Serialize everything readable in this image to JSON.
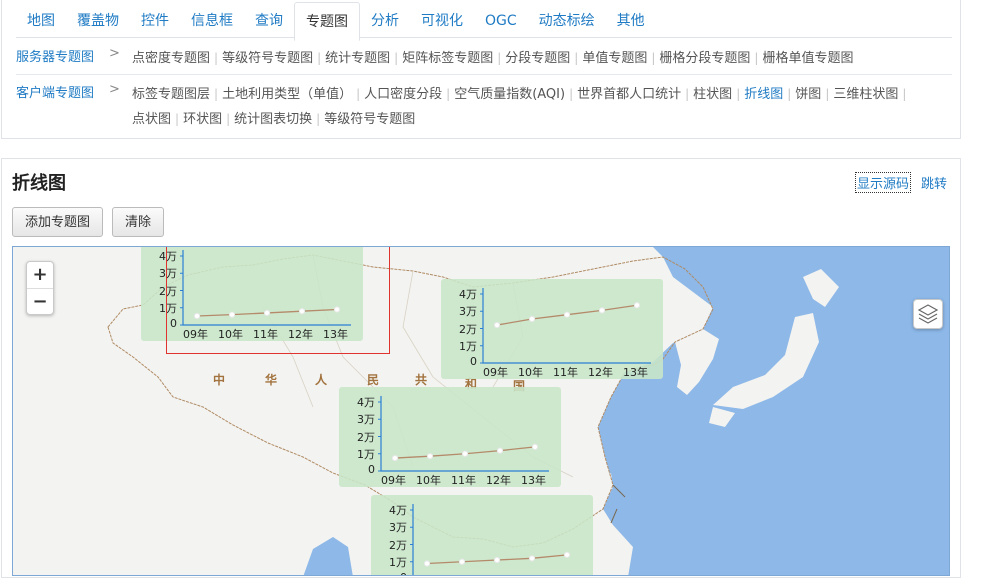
{
  "tabs": [
    {
      "label": "地图"
    },
    {
      "label": "覆盖物"
    },
    {
      "label": "控件"
    },
    {
      "label": "信息框"
    },
    {
      "label": "查询"
    },
    {
      "label": "专题图"
    },
    {
      "label": "分析"
    },
    {
      "label": "可视化"
    },
    {
      "label": "OGC"
    },
    {
      "label": "动态标绘"
    },
    {
      "label": "其他"
    }
  ],
  "active_tab": "专题图",
  "server_row": {
    "head": "服务器专题图",
    "arrow": ">",
    "items": [
      "点密度专题图",
      "等级符号专题图",
      "统计专题图",
      "矩阵标签专题图",
      "分段专题图",
      "单值专题图",
      "栅格分段专题图",
      "栅格单值专题图"
    ]
  },
  "client_row": {
    "head": "客户端专题图",
    "arrow": ">",
    "items": [
      "标签专题图层",
      "土地利用类型（单值）",
      "人口密度分段",
      "空气质量指数(AQI)",
      "世界首都人口统计",
      "柱状图",
      "折线图",
      "饼图",
      "三维柱状图",
      "点状图",
      "环状图",
      "统计图表切换",
      "等级符号专题图"
    ],
    "current": "折线图"
  },
  "page": {
    "title": "折线图",
    "show_source": "显示源码",
    "jump": "跳转",
    "add_button": "添加专题图",
    "clear_button": "清除"
  },
  "map": {
    "zoom_in": "+",
    "zoom_out": "−",
    "country_label": [
      "中",
      "华",
      "人",
      "民",
      "共",
      "和",
      "国"
    ],
    "colors": {
      "sea": "#8db8e8",
      "land": "#f3f3f1",
      "border": "#b08b64",
      "chart_bg": "#c8e6c8",
      "line": "#b48a6a",
      "axis": "#2a7fd4"
    }
  },
  "chart_data": {
    "type": "line",
    "categories": [
      "09年",
      "10年",
      "11年",
      "12年",
      "13年"
    ],
    "ytick_labels": [
      "0",
      "1万",
      "2万",
      "3万",
      "4万"
    ],
    "ylim": [
      0,
      40000
    ],
    "charts": [
      {
        "values": [
          5200,
          6000,
          7000,
          8000,
          9000
        ]
      },
      {
        "values": [
          22000,
          25500,
          28000,
          30500,
          33500
        ]
      },
      {
        "values": [
          7500,
          8600,
          10000,
          11800,
          14000
        ]
      },
      {
        "values": [
          9000,
          10000,
          11000,
          12000,
          14000
        ]
      }
    ]
  }
}
